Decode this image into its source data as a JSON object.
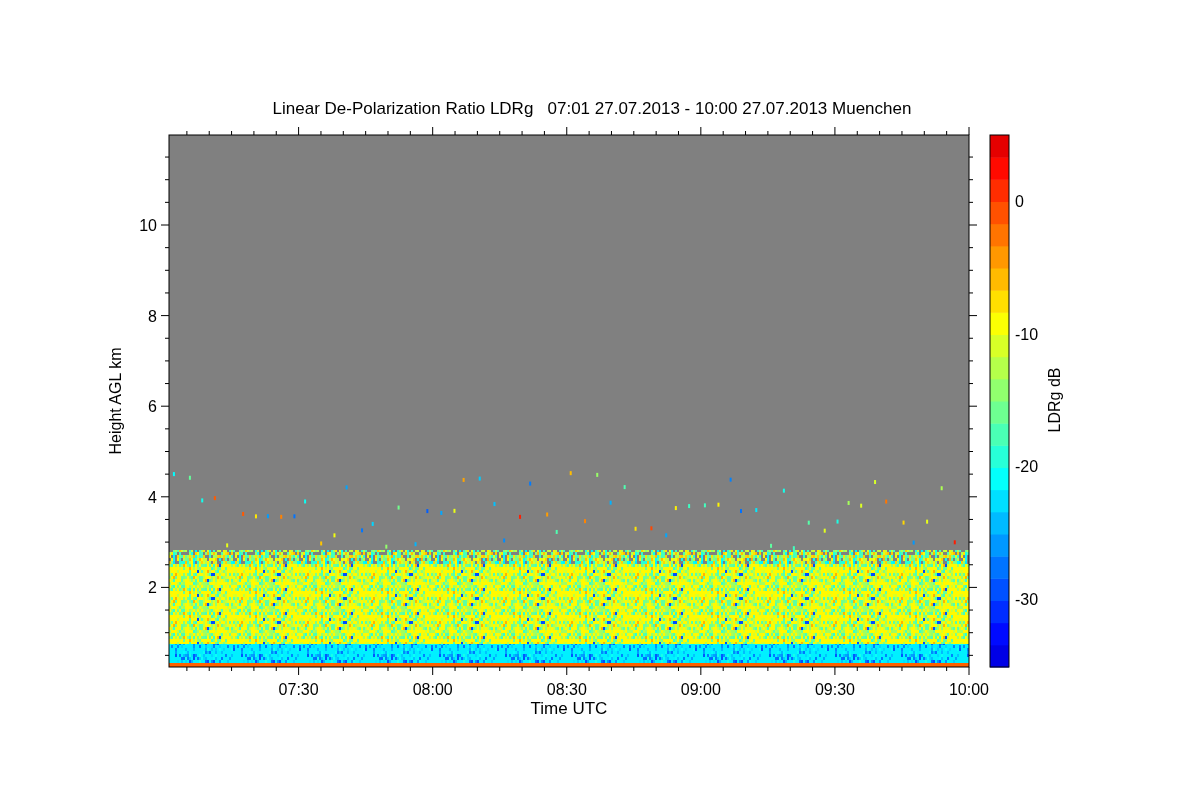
{
  "title": "Linear De-Polarization Ratio LDRg   07:01 27.07.2013 - 10:00 27.07.2013 Muenchen",
  "x_axis": {
    "label": "Time UTC",
    "ticks": [
      "07:30",
      "08:00",
      "08:30",
      "09:00",
      "09:30",
      "10:00"
    ]
  },
  "y_axis": {
    "label": "Height AGL km",
    "ticks": [
      "10",
      "8",
      "6",
      "4",
      "2"
    ]
  },
  "colorbar": {
    "label": "LDRg dB",
    "ticks": [
      "0",
      "-10",
      "-20",
      "-30"
    ]
  }
}
